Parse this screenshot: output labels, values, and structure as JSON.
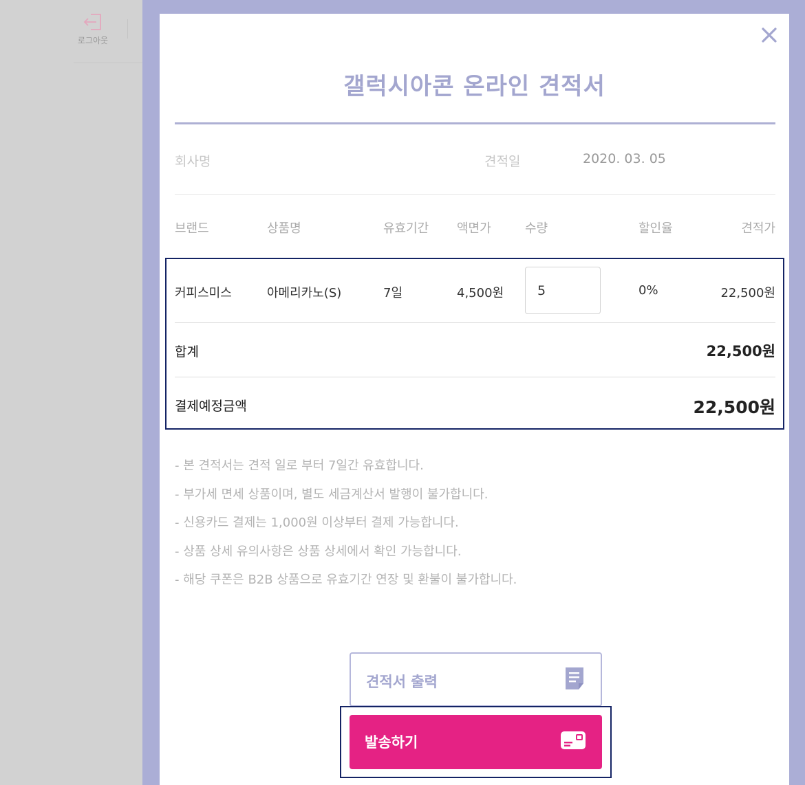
{
  "sidebar": {
    "logout_label": "로그아웃"
  },
  "modal": {
    "title": "갤럭시아콘 온라인 견적서",
    "company_label": "회사명",
    "company_value": "",
    "date_label": "견적일",
    "date_value": "2020. 03. 05"
  },
  "table": {
    "headers": [
      "브랜드",
      "상품명",
      "유효기간",
      "액면가",
      "수량",
      "할인율",
      "견적가"
    ],
    "row": {
      "brand": "커피스미스",
      "product": "아메리카노(S)",
      "validity": "7일",
      "face_value": "4,500원",
      "quantity": "5",
      "discount": "0%",
      "price": "22,500원"
    }
  },
  "summary": {
    "total_label": "합계",
    "total_value": "22,500원",
    "payment_label": "결제예정금액",
    "payment_value": "22,500원"
  },
  "notes": [
    "- 본 견적서는 견적 일로 부터 7일간 유효합니다.",
    "- 부가세 면세 상품이며, 별도 세금계산서 발행이 불가합니다.",
    "- 신용카드 결제는 1,000원 이상부터 결제 가능합니다.",
    "- 상품 상세 유의사항은 상품 상세에서 확인 가능합니다.",
    "- 해당 쿠폰은 B2B 상품으로 유효기간 연장 및 환불이 불가합니다."
  ],
  "buttons": {
    "print_label": "견적서 출력",
    "send_label": "발송하기"
  },
  "icons": {
    "logout": "logout-icon",
    "close": "close-icon",
    "print": "document-icon",
    "send": "card-icon"
  },
  "colors": {
    "overlay": "#abaed6",
    "accent": "#a3a6cf",
    "send_button": "#e52284",
    "highlight": "#142364"
  }
}
